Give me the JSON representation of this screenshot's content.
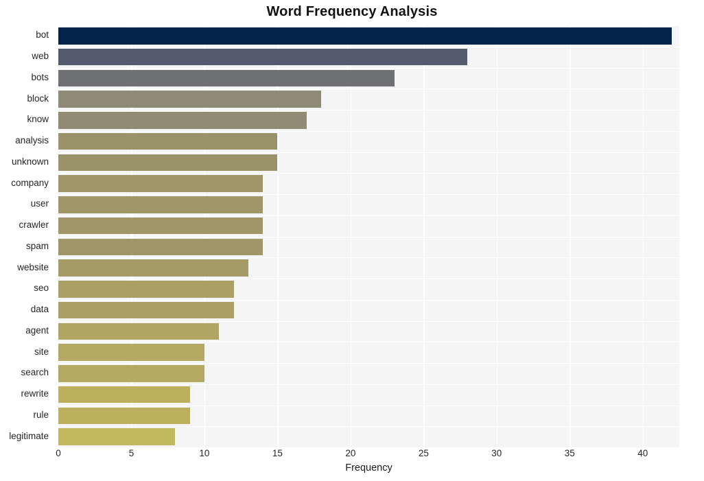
{
  "chart_data": {
    "type": "bar",
    "orientation": "horizontal",
    "title": "Word Frequency Analysis",
    "xlabel": "Frequency",
    "ylabel": "",
    "categories": [
      "bot",
      "web",
      "bots",
      "block",
      "know",
      "analysis",
      "unknown",
      "company",
      "user",
      "crawler",
      "spam",
      "website",
      "seo",
      "data",
      "agent",
      "site",
      "search",
      "rewrite",
      "rule",
      "legitimate"
    ],
    "values": [
      42,
      28,
      23,
      18,
      17,
      15,
      15,
      14,
      14,
      14,
      14,
      13,
      12,
      12,
      11,
      10,
      10,
      9,
      9,
      8
    ],
    "bar_colors": [
      "#04234a",
      "#555b6e",
      "#6f7074",
      "#8e8a77",
      "#908b72",
      "#9a9269",
      "#9a9269",
      "#a09769",
      "#a09769",
      "#a09769",
      "#a09769",
      "#a59b67",
      "#aaa065",
      "#aaa065",
      "#b0a563",
      "#b5aa61",
      "#b5aa61",
      "#bcb05f",
      "#bcb05f",
      "#c3b75c"
    ],
    "xticks": [
      0,
      5,
      10,
      15,
      20,
      25,
      30,
      35,
      40
    ],
    "xtick_labels": [
      "0",
      "5",
      "10",
      "15",
      "20",
      "25",
      "30",
      "35",
      "40"
    ],
    "xlim": [
      0,
      42.5
    ],
    "grid": true,
    "legend": "none",
    "plot_background": "#f5f5f6",
    "gridline_color": "#ffffff",
    "figure_background": "#ffffff"
  }
}
